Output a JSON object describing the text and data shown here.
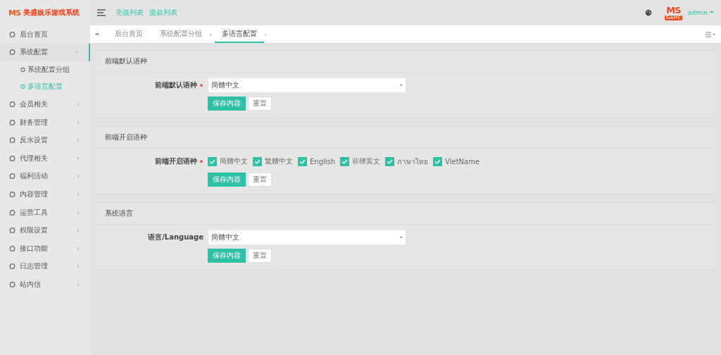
{
  "brand": {
    "mark": "MS",
    "title": "美盛娱乐游戏系统"
  },
  "header": {
    "links": [
      "充值列表",
      "提款列表"
    ],
    "avatar_mark": "MS",
    "avatar_sub": "GAME",
    "user": "admin"
  },
  "sidebar": {
    "items": [
      {
        "label": "后台首页",
        "selected": false
      },
      {
        "label": "系统配置",
        "selected": false,
        "expanded": true,
        "children": [
          {
            "label": "系统配置分组",
            "selected": false
          },
          {
            "label": "多语言配置",
            "selected": true
          }
        ]
      },
      {
        "label": "会员相关",
        "selected": false,
        "expanded": false
      },
      {
        "label": "财务管理",
        "selected": false,
        "expanded": false
      },
      {
        "label": "反水设置",
        "selected": false,
        "expanded": false
      },
      {
        "label": "代理相关",
        "selected": false,
        "expanded": false
      },
      {
        "label": "福利活动",
        "selected": false,
        "expanded": false
      },
      {
        "label": "内容管理",
        "selected": false,
        "expanded": false
      },
      {
        "label": "运营工具",
        "selected": false,
        "expanded": false
      },
      {
        "label": "权限设置",
        "selected": false,
        "expanded": false
      },
      {
        "label": "接口功能",
        "selected": false,
        "expanded": false
      },
      {
        "label": "日志管理",
        "selected": false,
        "expanded": false
      },
      {
        "label": "站内信",
        "selected": false,
        "expanded": false
      }
    ]
  },
  "tabs": [
    {
      "label": "后台首页",
      "selected": false,
      "closable": false
    },
    {
      "label": "系统配置分组",
      "selected": false,
      "closable": true
    },
    {
      "label": "多语言配置",
      "selected": true,
      "closable": true
    }
  ],
  "cards": [
    {
      "title": "前端默认语种",
      "kind": "select",
      "label": "前端默认语种",
      "required": true,
      "value": "簡體中文",
      "save": "保存内容",
      "reset": "重置"
    },
    {
      "title": "前端开启语种",
      "kind": "checkboxes",
      "label": "前端开启语种",
      "required": true,
      "options": [
        {
          "label": "簡體中文",
          "checked": true
        },
        {
          "label": "繁體中文",
          "checked": true
        },
        {
          "label": "English",
          "checked": true
        },
        {
          "label": "菲律宾文",
          "checked": true
        },
        {
          "label": "ภาษาไทย",
          "checked": true
        },
        {
          "label": "VietName",
          "checked": true
        }
      ],
      "save": "保存内容",
      "reset": "重置"
    },
    {
      "title": "系统语言",
      "kind": "select",
      "label": "语言/Language",
      "required": false,
      "value": "簡體中文",
      "save": "保存内容",
      "reset": "重置"
    }
  ]
}
